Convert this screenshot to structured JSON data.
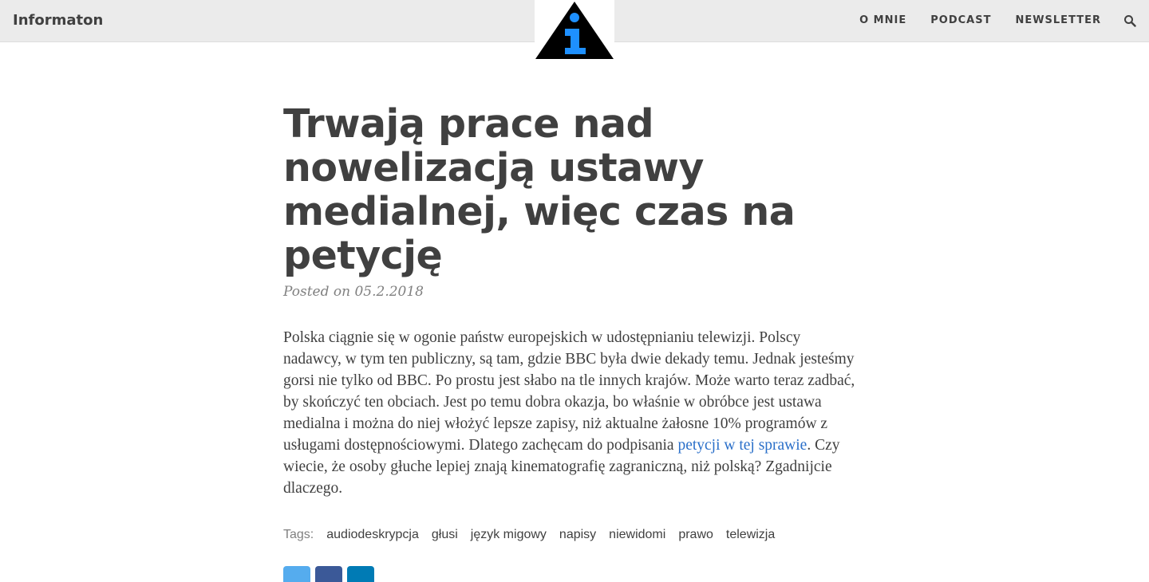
{
  "header": {
    "brand": "Informaton",
    "nav": [
      {
        "label": "O MNIE"
      },
      {
        "label": "PODCAST"
      },
      {
        "label": "NEWSLETTER"
      }
    ],
    "logo_icon": "info-icon",
    "search_icon": "search-icon"
  },
  "post": {
    "title": "Trwają prace nad nowelizacją ustawy medialnej, więc czas na petycję",
    "meta": "Posted on 05.2.2018",
    "paragraph_before_link": "Polska ciągnie się w ogonie państw europejskich w udostępnianiu telewizji. Polscy nadawcy, w tym ten publiczny, są tam, gdzie BBC była dwie dekady temu. Jednak jesteśmy gorsi nie tylko od BBC. Po prostu jest słabo na tle innych krajów. Może warto teraz zadbać, by skończyć ten obciach. Jest po temu dobra okazja, bo właśnie w obróbce jest ustawa medialna i można do niej włożyć lepsze zapisy, niż aktualne żałosne 10% programów z usługami dostępnościowymi. Dlatego zachęcam do podpisania ",
    "link_text": "petycji w tej sprawie",
    "paragraph_after_link": ". Czy wiecie, że osoby głuche lepiej znają kinematografię zagraniczną, niż polską? Zgadnijcie dlaczego."
  },
  "tags": {
    "label": "Tags:",
    "items": [
      "audiodeskrypcja",
      "głusi",
      "język migowy",
      "napisy",
      "niewidomi",
      "prawo",
      "telewizja"
    ]
  },
  "share": {
    "buttons": [
      {
        "icon": "twitter-icon",
        "color": "#55acee"
      },
      {
        "icon": "facebook-icon",
        "color": "#3b5998"
      },
      {
        "icon": "linkedin-icon",
        "color": "#007bb5"
      }
    ]
  },
  "colors": {
    "navbar_bg": "#ebebeb",
    "text": "#404040",
    "link": "#2a6fc9",
    "logo_accent": "#1e90ff"
  }
}
